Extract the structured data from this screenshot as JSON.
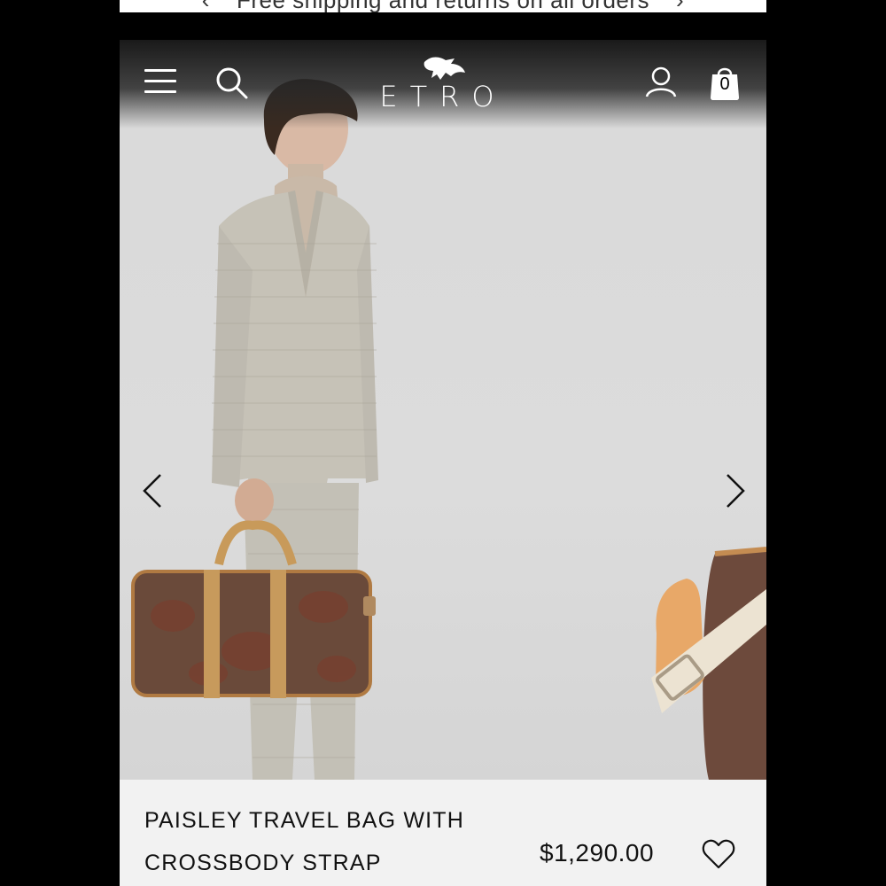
{
  "promo": {
    "text": "Free shipping and returns on all orders",
    "prev_icon": "chevron-left-icon",
    "next_icon": "chevron-right-icon"
  },
  "header": {
    "logo_text": "ETRO",
    "bag_count": "0",
    "icons": [
      "hamburger-menu-icon",
      "search-icon",
      "account-icon",
      "shopping-bag-icon"
    ]
  },
  "gallery": {
    "prev_icon": "chevron-left-icon",
    "next_icon": "chevron-right-icon"
  },
  "product": {
    "name_line1": "PAISLEY TRAVEL BAG WITH",
    "name_line2": "CROSSBODY STRAP",
    "price": "$1,290.00",
    "wishlist_icon": "heart-outline-icon"
  },
  "colors": {
    "background": "#000000",
    "hero_bg": "#d9d9d9",
    "info_bg": "#f2f2f2",
    "text": "#111111"
  }
}
